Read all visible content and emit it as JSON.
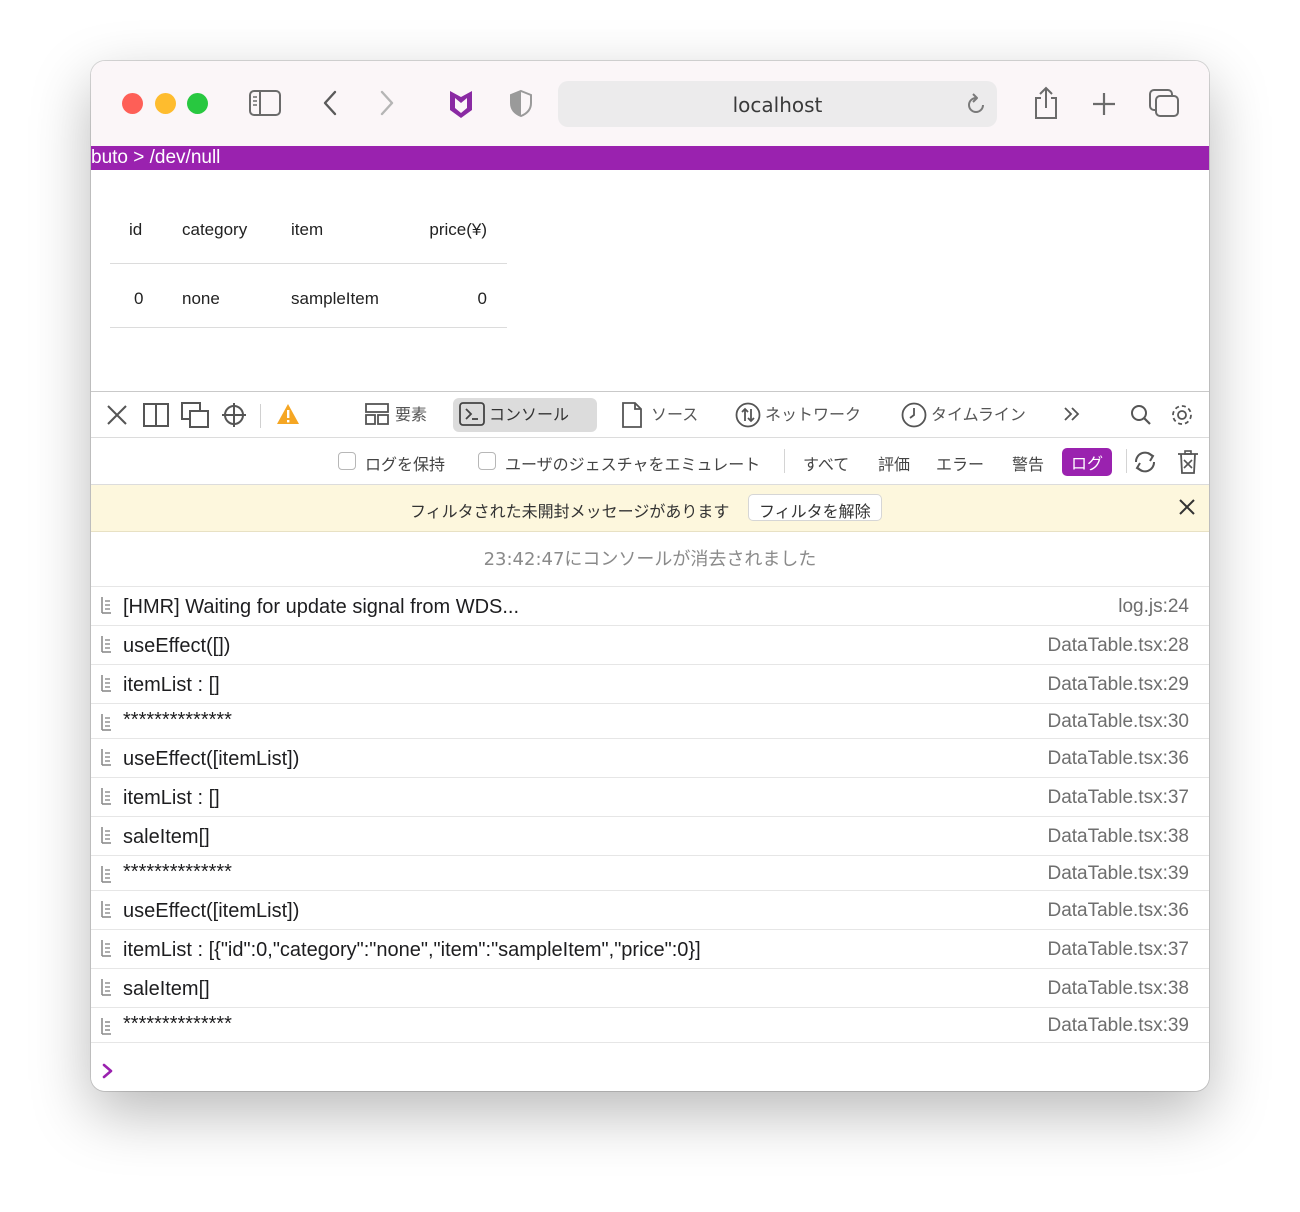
{
  "browser": {
    "url": "localhost"
  },
  "page": {
    "breadcrumb": "buto > /dev/null",
    "table": {
      "headers": [
        "id",
        "category",
        "item",
        "price(¥)"
      ],
      "rows": [
        [
          "0",
          "none",
          "sampleItem",
          "0"
        ]
      ]
    }
  },
  "devtools": {
    "tabs": [
      "要素",
      "コンソール",
      "ソース",
      "ネットワーク",
      "タイムライン"
    ],
    "active_tab": "コンソール",
    "filters": {
      "preserve_log": "ログを保持",
      "emulate_gesture": "ユーザのジェスチャをエミュレート",
      "levels": [
        "すべて",
        "評価",
        "エラー",
        "警告",
        "ログ"
      ],
      "active_level": "ログ"
    },
    "banner": {
      "message": "フィルタされた未開封メッセージがあります",
      "clear_button": "フィルタを解除"
    },
    "cleared_message": "23:42:47にコンソールが消去されました",
    "logs": [
      {
        "msg": "[HMR] Waiting for update signal from WDS...",
        "src": "log.js:24"
      },
      {
        "msg": "useEffect([])",
        "src": "DataTable.tsx:28"
      },
      {
        "msg": "itemList : []",
        "src": "DataTable.tsx:29"
      },
      {
        "msg": "**************",
        "src": "DataTable.tsx:30"
      },
      {
        "msg": "useEffect([itemList])",
        "src": "DataTable.tsx:36"
      },
      {
        "msg": "itemList : []",
        "src": "DataTable.tsx:37"
      },
      {
        "msg": "saleItem[]",
        "src": "DataTable.tsx:38"
      },
      {
        "msg": "**************",
        "src": "DataTable.tsx:39"
      },
      {
        "msg": "useEffect([itemList])",
        "src": "DataTable.tsx:36"
      },
      {
        "msg": "itemList : [{\"id\":0,\"category\":\"none\",\"item\":\"sampleItem\",\"price\":0}]",
        "src": "DataTable.tsx:37"
      },
      {
        "msg": "saleItem[]",
        "src": "DataTable.tsx:38"
      },
      {
        "msg": "**************",
        "src": "DataTable.tsx:39"
      }
    ]
  },
  "colors": {
    "accent": "#9a22af",
    "banner_bg": "#fdf7dd",
    "warning": "#f5a623"
  }
}
